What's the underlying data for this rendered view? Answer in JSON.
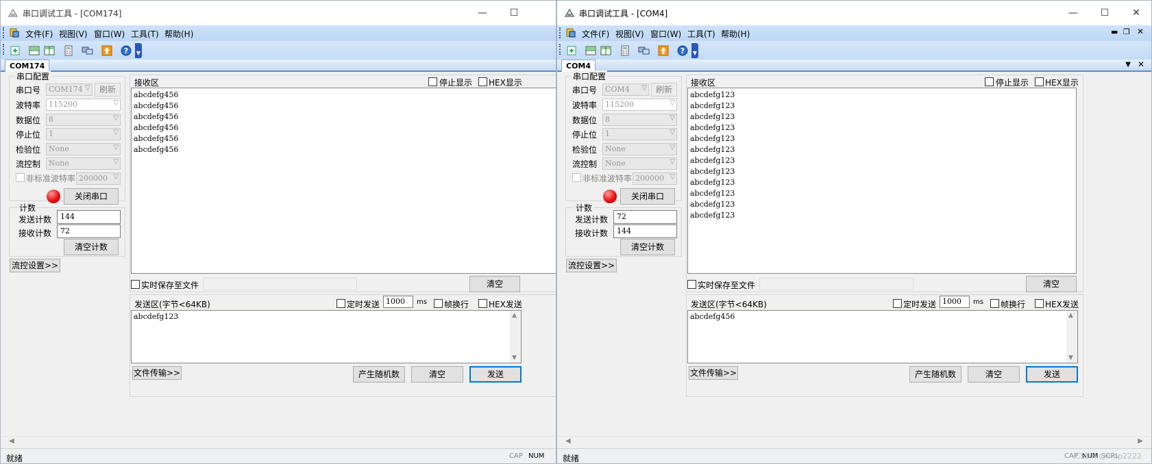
{
  "left": {
    "title": "串口调试工具 - [COM174]",
    "menu": [
      "文件(F)",
      "视图(V)",
      "窗口(W)",
      "工具(T)",
      "帮助(H)"
    ],
    "doc_tab": "COM174",
    "config_title": "串口配置",
    "port_label": "串口号",
    "port_value": "COM174",
    "refresh_label": "刷新",
    "baud_label": "波特率",
    "baud_value": "115200",
    "databits_label": "数据位",
    "databits_value": "8",
    "stopbits_label": "停止位",
    "stopbits_value": "1",
    "parity_label": "检验位",
    "parity_value": "None",
    "flow_label": "流控制",
    "flow_value": "None",
    "nonstd_label": "非标准波特率",
    "nonstd_value": "200000",
    "close_port_label": "关闭串口",
    "count_title": "计数",
    "send_count_label": "发送计数",
    "send_count_value": "144",
    "recv_count_label": "接收计数",
    "recv_count_value": "72",
    "clear_count_label": "清空计数",
    "flow_settings_label": "流控设置>>",
    "recv_title": "接收区",
    "stop_display_label": "停止显示",
    "hex_display_label": "HEX显示",
    "recv_lines": [
      "abcdefg456",
      "abcdefg456",
      "abcdefg456",
      "abcdefg456",
      "abcdefg456",
      "abcdefg456"
    ],
    "save_file_label": "实时保存至文件",
    "clear_recv_label": "清空",
    "send_title": "发送区(字节<64KB)",
    "timed_send_label": "定时发送",
    "interval_value": "1000",
    "ms_label": "ms",
    "frame_newline_label": "帧换行",
    "hex_send_label": "HEX发送",
    "send_text": "abcdefg123",
    "file_transfer_label": "文件传输>>",
    "random_label": "产生随机数",
    "clear_send_label": "清空",
    "send_label": "发送",
    "status_text": "就绪",
    "cap_label": "CAP",
    "num_label": "NUM"
  },
  "right": {
    "title": "串口调试工具 - [COM4]",
    "menu": [
      "文件(F)",
      "视图(V)",
      "窗口(W)",
      "工具(T)",
      "帮助(H)"
    ],
    "doc_tab": "COM4",
    "config_title": "串口配置",
    "port_label": "串口号",
    "port_value": "COM4",
    "refresh_label": "刷新",
    "baud_label": "波特率",
    "baud_value": "115200",
    "databits_label": "数据位",
    "databits_value": "8",
    "stopbits_label": "停止位",
    "stopbits_value": "1",
    "parity_label": "检验位",
    "parity_value": "None",
    "flow_label": "流控制",
    "flow_value": "None",
    "nonstd_label": "非标准波特率",
    "nonstd_value": "200000",
    "close_port_label": "关闭串口",
    "count_title": "计数",
    "send_count_label": "发送计数",
    "send_count_value": "72",
    "recv_count_label": "接收计数",
    "recv_count_value": "144",
    "clear_count_label": "清空计数",
    "flow_settings_label": "流控设置>>",
    "recv_title": "接收区",
    "stop_display_label": "停止显示",
    "hex_display_label": "HEX显示",
    "recv_lines": [
      "abcdefg123",
      "abcdefg123",
      "abcdefg123",
      "abcdefg123",
      "abcdefg123",
      "abcdefg123",
      "abcdefg123",
      "abcdefg123",
      "abcdefg123",
      "abcdefg123",
      "abcdefg123",
      "abcdefg123"
    ],
    "save_file_label": "实时保存至文件",
    "clear_recv_label": "清空",
    "send_title": "发送区(字节<64KB)",
    "timed_send_label": "定时发送",
    "interval_value": "1000",
    "ms_label": "ms",
    "frame_newline_label": "帧换行",
    "hex_send_label": "HEX发送",
    "send_text": "abcdefg456",
    "file_transfer_label": "文件传输>>",
    "random_label": "产生随机数",
    "clear_send_label": "清空",
    "send_label": "发送",
    "status_text": "就绪",
    "cap_label": "CAP",
    "num_label": "NUM",
    "scrl_label": "SCRL",
    "watermark": "CSDN @loop2222"
  },
  "icons": [
    "app-icon",
    "new-icon",
    "split-horizontal-icon",
    "split-vertical-icon",
    "calculator-icon",
    "monitor-icon",
    "upload-icon",
    "help-icon"
  ]
}
